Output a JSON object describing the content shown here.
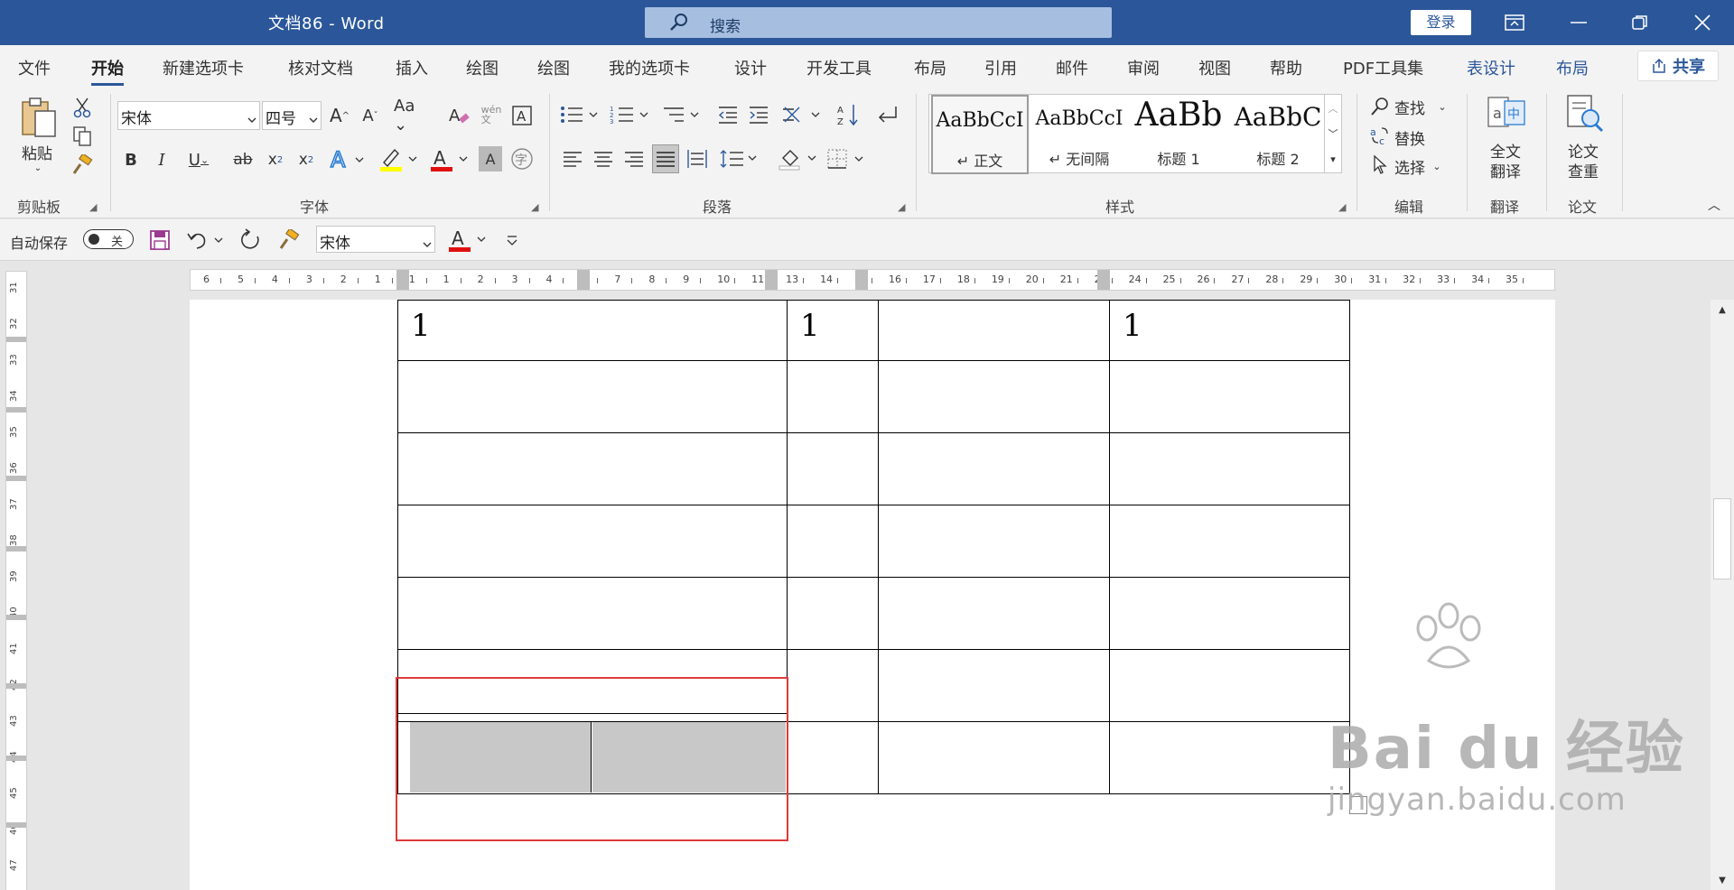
{
  "window": {
    "title": "文档86  -  Word",
    "search_placeholder": "搜索",
    "login": "登录"
  },
  "tabs": [
    "文件",
    "开始",
    "新建选项卡",
    "核对文档",
    "插入",
    "绘图",
    "绘图",
    "我的选项卡",
    "设计",
    "开发工具",
    "布局",
    "引用",
    "邮件",
    "审阅",
    "视图",
    "帮助",
    "PDF工具集",
    "表设计",
    "布局"
  ],
  "active_tab": "开始",
  "share": "共享",
  "ribbon": {
    "clipboard": {
      "label": "剪贴板",
      "paste": "粘贴"
    },
    "font": {
      "label": "字体",
      "name": "宋体",
      "size": "四号"
    },
    "paragraph": {
      "label": "段落"
    },
    "styles": {
      "label": "样式",
      "items": [
        {
          "sample": "AaBbCcI",
          "name": "↵ 正文"
        },
        {
          "sample": "AaBbCcI",
          "name": "↵ 无间隔"
        },
        {
          "sample": "AaBb",
          "name": "标题 1"
        },
        {
          "sample": "AaBbC",
          "name": "标题 2"
        }
      ]
    },
    "editing": {
      "label": "编辑",
      "find": "查找",
      "replace": "替换",
      "select": "选择"
    },
    "translate": {
      "label": "翻译",
      "full_line1": "全文",
      "full_line2": "翻译"
    },
    "paper": {
      "label": "论文",
      "check_line1": "论文",
      "check_line2": "查重"
    }
  },
  "qat": {
    "autosave_label": "自动保存",
    "autosave_state": "关",
    "font_name": "宋体"
  },
  "ruler": {
    "h_numbers": [
      "6",
      "5",
      "4",
      "3",
      "2",
      "1",
      "1",
      "1",
      "2",
      "3",
      "4",
      "5",
      "7",
      "8",
      "9",
      "10",
      "11",
      "13",
      "14",
      "5",
      "16",
      "17",
      "18",
      "19",
      "20",
      "21",
      "23",
      "24",
      "25",
      "26",
      "27",
      "28",
      "29",
      "30",
      "31",
      "32",
      "33",
      "34",
      "35"
    ],
    "v_numbers": [
      "31",
      "32",
      "33",
      "34",
      "35",
      "36",
      "37",
      "38",
      "39",
      "40",
      "41",
      "42",
      "43",
      "44",
      "45",
      "46",
      "47"
    ]
  },
  "document": {
    "table": [
      [
        "1",
        "1",
        "",
        "1"
      ],
      [
        "",
        "",
        "",
        ""
      ],
      [
        "",
        "",
        "",
        ""
      ],
      [
        "",
        "",
        "",
        ""
      ],
      [
        "",
        "",
        "",
        ""
      ],
      [
        "",
        "",
        "",
        ""
      ],
      [
        "",
        "",
        "",
        ""
      ]
    ]
  },
  "watermark": {
    "brand": "Bai  du 经验",
    "url": "jingyan.baidu.com"
  }
}
